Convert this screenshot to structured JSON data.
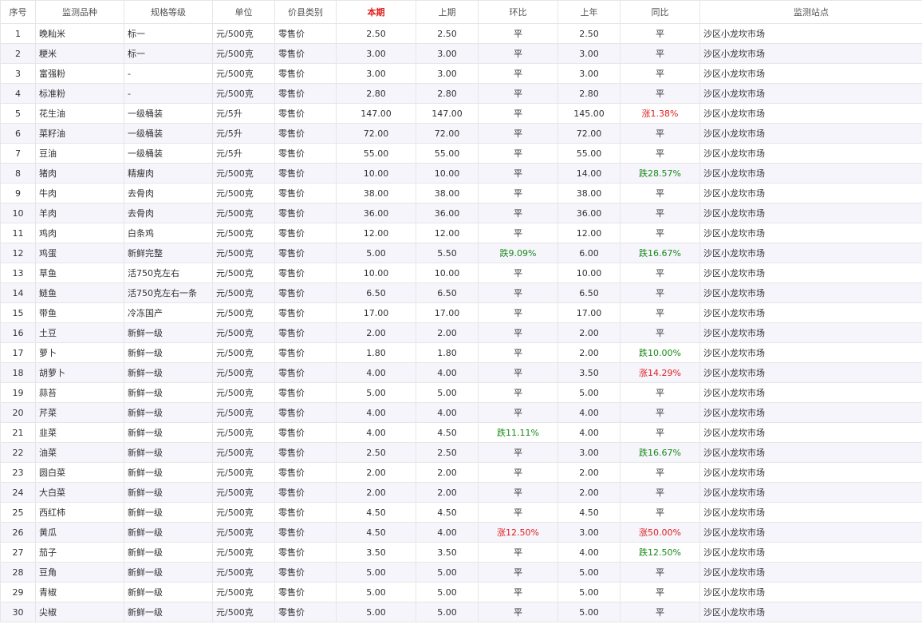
{
  "headers": [
    "序号",
    "监测品种",
    "规格等级",
    "单位",
    "价县类别",
    "本期",
    "上期",
    "环比",
    "上年",
    "同比",
    "监测站点"
  ],
  "rows": [
    {
      "no": "1",
      "name": "晚籼米",
      "spec": "标一",
      "unit": "元/500克",
      "type": "零售价",
      "cur": "2.50",
      "prev": "2.50",
      "mom": "平",
      "mom_dir": "flat",
      "ly": "2.50",
      "yoy": "平",
      "yoy_dir": "flat",
      "site": "沙区小龙坎市场"
    },
    {
      "no": "2",
      "name": "粳米",
      "spec": "标一",
      "unit": "元/500克",
      "type": "零售价",
      "cur": "3.00",
      "prev": "3.00",
      "mom": "平",
      "mom_dir": "flat",
      "ly": "3.00",
      "yoy": "平",
      "yoy_dir": "flat",
      "site": "沙区小龙坎市场"
    },
    {
      "no": "3",
      "name": "富强粉",
      "spec": "-",
      "unit": "元/500克",
      "type": "零售价",
      "cur": "3.00",
      "prev": "3.00",
      "mom": "平",
      "mom_dir": "flat",
      "ly": "3.00",
      "yoy": "平",
      "yoy_dir": "flat",
      "site": "沙区小龙坎市场"
    },
    {
      "no": "4",
      "name": "标准粉",
      "spec": "-",
      "unit": "元/500克",
      "type": "零售价",
      "cur": "2.80",
      "prev": "2.80",
      "mom": "平",
      "mom_dir": "flat",
      "ly": "2.80",
      "yoy": "平",
      "yoy_dir": "flat",
      "site": "沙区小龙坎市场"
    },
    {
      "no": "5",
      "name": "花生油",
      "spec": "一级桶装",
      "unit": "元/5升",
      "type": "零售价",
      "cur": "147.00",
      "prev": "147.00",
      "mom": "平",
      "mom_dir": "flat",
      "ly": "145.00",
      "yoy": "涨1.38%",
      "yoy_dir": "up",
      "site": "沙区小龙坎市场"
    },
    {
      "no": "6",
      "name": "菜籽油",
      "spec": "一级桶装",
      "unit": "元/5升",
      "type": "零售价",
      "cur": "72.00",
      "prev": "72.00",
      "mom": "平",
      "mom_dir": "flat",
      "ly": "72.00",
      "yoy": "平",
      "yoy_dir": "flat",
      "site": "沙区小龙坎市场"
    },
    {
      "no": "7",
      "name": "豆油",
      "spec": "一级桶装",
      "unit": "元/5升",
      "type": "零售价",
      "cur": "55.00",
      "prev": "55.00",
      "mom": "平",
      "mom_dir": "flat",
      "ly": "55.00",
      "yoy": "平",
      "yoy_dir": "flat",
      "site": "沙区小龙坎市场"
    },
    {
      "no": "8",
      "name": "猪肉",
      "spec": "精瘦肉",
      "unit": "元/500克",
      "type": "零售价",
      "cur": "10.00",
      "prev": "10.00",
      "mom": "平",
      "mom_dir": "flat",
      "ly": "14.00",
      "yoy": "跌28.57%",
      "yoy_dir": "down",
      "site": "沙区小龙坎市场"
    },
    {
      "no": "9",
      "name": "牛肉",
      "spec": "去骨肉",
      "unit": "元/500克",
      "type": "零售价",
      "cur": "38.00",
      "prev": "38.00",
      "mom": "平",
      "mom_dir": "flat",
      "ly": "38.00",
      "yoy": "平",
      "yoy_dir": "flat",
      "site": "沙区小龙坎市场"
    },
    {
      "no": "10",
      "name": "羊肉",
      "spec": "去骨肉",
      "unit": "元/500克",
      "type": "零售价",
      "cur": "36.00",
      "prev": "36.00",
      "mom": "平",
      "mom_dir": "flat",
      "ly": "36.00",
      "yoy": "平",
      "yoy_dir": "flat",
      "site": "沙区小龙坎市场"
    },
    {
      "no": "11",
      "name": "鸡肉",
      "spec": "白条鸡",
      "unit": "元/500克",
      "type": "零售价",
      "cur": "12.00",
      "prev": "12.00",
      "mom": "平",
      "mom_dir": "flat",
      "ly": "12.00",
      "yoy": "平",
      "yoy_dir": "flat",
      "site": "沙区小龙坎市场"
    },
    {
      "no": "12",
      "name": "鸡蛋",
      "spec": "新鲜完整",
      "unit": "元/500克",
      "type": "零售价",
      "cur": "5.00",
      "prev": "5.50",
      "mom": "跌9.09%",
      "mom_dir": "down",
      "ly": "6.00",
      "yoy": "跌16.67%",
      "yoy_dir": "down",
      "site": "沙区小龙坎市场"
    },
    {
      "no": "13",
      "name": "草鱼",
      "spec": "活750克左右",
      "unit": "元/500克",
      "type": "零售价",
      "cur": "10.00",
      "prev": "10.00",
      "mom": "平",
      "mom_dir": "flat",
      "ly": "10.00",
      "yoy": "平",
      "yoy_dir": "flat",
      "site": "沙区小龙坎市场"
    },
    {
      "no": "14",
      "name": "鲢鱼",
      "spec": "活750克左右一条",
      "unit": "元/500克",
      "type": "零售价",
      "cur": "6.50",
      "prev": "6.50",
      "mom": "平",
      "mom_dir": "flat",
      "ly": "6.50",
      "yoy": "平",
      "yoy_dir": "flat",
      "site": "沙区小龙坎市场"
    },
    {
      "no": "15",
      "name": "带鱼",
      "spec": "冷冻国产",
      "unit": "元/500克",
      "type": "零售价",
      "cur": "17.00",
      "prev": "17.00",
      "mom": "平",
      "mom_dir": "flat",
      "ly": "17.00",
      "yoy": "平",
      "yoy_dir": "flat",
      "site": "沙区小龙坎市场"
    },
    {
      "no": "16",
      "name": "土豆",
      "spec": "新鲜一级",
      "unit": "元/500克",
      "type": "零售价",
      "cur": "2.00",
      "prev": "2.00",
      "mom": "平",
      "mom_dir": "flat",
      "ly": "2.00",
      "yoy": "平",
      "yoy_dir": "flat",
      "site": "沙区小龙坎市场"
    },
    {
      "no": "17",
      "name": "萝卜",
      "spec": "新鲜一级",
      "unit": "元/500克",
      "type": "零售价",
      "cur": "1.80",
      "prev": "1.80",
      "mom": "平",
      "mom_dir": "flat",
      "ly": "2.00",
      "yoy": "跌10.00%",
      "yoy_dir": "down",
      "site": "沙区小龙坎市场"
    },
    {
      "no": "18",
      "name": "胡萝卜",
      "spec": "新鲜一级",
      "unit": "元/500克",
      "type": "零售价",
      "cur": "4.00",
      "prev": "4.00",
      "mom": "平",
      "mom_dir": "flat",
      "ly": "3.50",
      "yoy": "涨14.29%",
      "yoy_dir": "up",
      "site": "沙区小龙坎市场"
    },
    {
      "no": "19",
      "name": "蒜苔",
      "spec": "新鲜一级",
      "unit": "元/500克",
      "type": "零售价",
      "cur": "5.00",
      "prev": "5.00",
      "mom": "平",
      "mom_dir": "flat",
      "ly": "5.00",
      "yoy": "平",
      "yoy_dir": "flat",
      "site": "沙区小龙坎市场"
    },
    {
      "no": "20",
      "name": "芹菜",
      "spec": "新鲜一级",
      "unit": "元/500克",
      "type": "零售价",
      "cur": "4.00",
      "prev": "4.00",
      "mom": "平",
      "mom_dir": "flat",
      "ly": "4.00",
      "yoy": "平",
      "yoy_dir": "flat",
      "site": "沙区小龙坎市场"
    },
    {
      "no": "21",
      "name": "韭菜",
      "spec": "新鲜一级",
      "unit": "元/500克",
      "type": "零售价",
      "cur": "4.00",
      "prev": "4.50",
      "mom": "跌11.11%",
      "mom_dir": "down",
      "ly": "4.00",
      "yoy": "平",
      "yoy_dir": "flat",
      "site": "沙区小龙坎市场"
    },
    {
      "no": "22",
      "name": "油菜",
      "spec": "新鲜一级",
      "unit": "元/500克",
      "type": "零售价",
      "cur": "2.50",
      "prev": "2.50",
      "mom": "平",
      "mom_dir": "flat",
      "ly": "3.00",
      "yoy": "跌16.67%",
      "yoy_dir": "down",
      "site": "沙区小龙坎市场"
    },
    {
      "no": "23",
      "name": "圆白菜",
      "spec": "新鲜一级",
      "unit": "元/500克",
      "type": "零售价",
      "cur": "2.00",
      "prev": "2.00",
      "mom": "平",
      "mom_dir": "flat",
      "ly": "2.00",
      "yoy": "平",
      "yoy_dir": "flat",
      "site": "沙区小龙坎市场"
    },
    {
      "no": "24",
      "name": "大白菜",
      "spec": "新鲜一级",
      "unit": "元/500克",
      "type": "零售价",
      "cur": "2.00",
      "prev": "2.00",
      "mom": "平",
      "mom_dir": "flat",
      "ly": "2.00",
      "yoy": "平",
      "yoy_dir": "flat",
      "site": "沙区小龙坎市场"
    },
    {
      "no": "25",
      "name": "西红柿",
      "spec": "新鲜一级",
      "unit": "元/500克",
      "type": "零售价",
      "cur": "4.50",
      "prev": "4.50",
      "mom": "平",
      "mom_dir": "flat",
      "ly": "4.50",
      "yoy": "平",
      "yoy_dir": "flat",
      "site": "沙区小龙坎市场"
    },
    {
      "no": "26",
      "name": "黄瓜",
      "spec": "新鲜一级",
      "unit": "元/500克",
      "type": "零售价",
      "cur": "4.50",
      "prev": "4.00",
      "mom": "涨12.50%",
      "mom_dir": "up",
      "ly": "3.00",
      "yoy": "涨50.00%",
      "yoy_dir": "up",
      "site": "沙区小龙坎市场"
    },
    {
      "no": "27",
      "name": "茄子",
      "spec": "新鲜一级",
      "unit": "元/500克",
      "type": "零售价",
      "cur": "3.50",
      "prev": "3.50",
      "mom": "平",
      "mom_dir": "flat",
      "ly": "4.00",
      "yoy": "跌12.50%",
      "yoy_dir": "down",
      "site": "沙区小龙坎市场"
    },
    {
      "no": "28",
      "name": "豆角",
      "spec": "新鲜一级",
      "unit": "元/500克",
      "type": "零售价",
      "cur": "5.00",
      "prev": "5.00",
      "mom": "平",
      "mom_dir": "flat",
      "ly": "5.00",
      "yoy": "平",
      "yoy_dir": "flat",
      "site": "沙区小龙坎市场"
    },
    {
      "no": "29",
      "name": "青椒",
      "spec": "新鲜一级",
      "unit": "元/500克",
      "type": "零售价",
      "cur": "5.00",
      "prev": "5.00",
      "mom": "平",
      "mom_dir": "flat",
      "ly": "5.00",
      "yoy": "平",
      "yoy_dir": "flat",
      "site": "沙区小龙坎市场"
    },
    {
      "no": "30",
      "name": "尖椒",
      "spec": "新鲜一级",
      "unit": "元/500克",
      "type": "零售价",
      "cur": "5.00",
      "prev": "5.00",
      "mom": "平",
      "mom_dir": "flat",
      "ly": "5.00",
      "yoy": "平",
      "yoy_dir": "flat",
      "site": "沙区小龙坎市场"
    }
  ],
  "colors": {
    "up": "#e02020",
    "down": "#1a8a1a",
    "header_current": "#e02020",
    "row_alt": "#f6f5fc",
    "border": "#e6e6e6"
  }
}
